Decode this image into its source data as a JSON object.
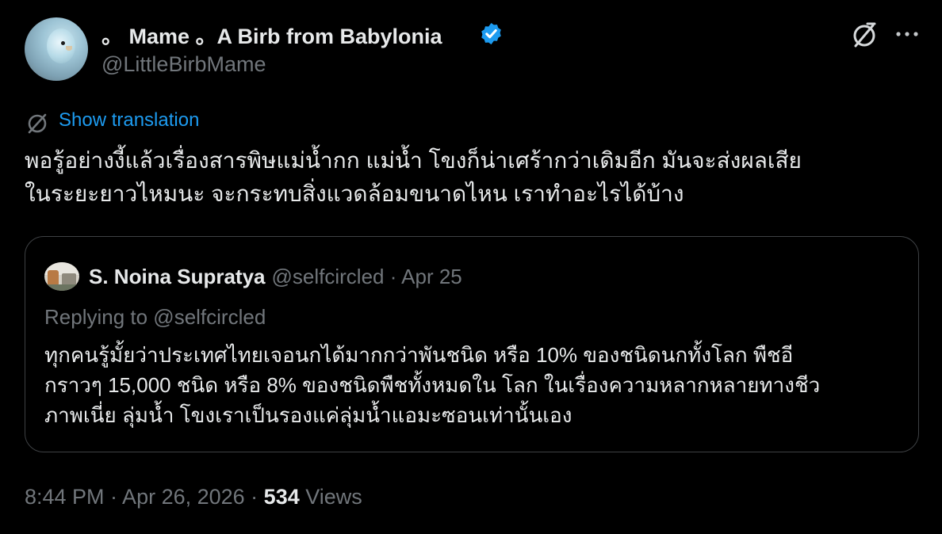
{
  "author": {
    "display_name": "。 Mame 。A Birb from Babylonia",
    "handle": "@LittleBirbMame"
  },
  "actions": {
    "grok_icon": "grok-icon",
    "more_icon": "more-icon"
  },
  "translation": {
    "label": "Show translation"
  },
  "tweet": {
    "line1": "พอรู้อย่างงี้แล้วเรื่องสารพิษแม่น้ำกก แม่น้ำ โขงก็น่าเศร้ากว่าเดิมอีก มันจะส่งผลเสีย",
    "line2": "ในระยะยาวไหมนะ จะกระทบสิ่งแวดล้อมขนาดไหน เราทำอะไรได้บ้าง"
  },
  "quoted": {
    "name": "S. Noina Supratya",
    "meta": "@selfcircled · Apr 25",
    "replying_to": "Replying to @selfcircled",
    "line1": "ทุกคนรู้มั้ยว่าประเทศไทยเจอนกได้มากกว่าพันชนิด หรือ 10% ของชนิดนกทั้งโลก พืชอี",
    "line2": "กราวๆ 15,000 ชนิด หรือ 8% ของชนิดพืชทั้งหมดใน โลก ในเรื่องความหลากหลายทางชีว",
    "line3": "ภาพเนี่ย ลุ่มน้ำ โขงเราเป็นรองแค่ลุ่มน้ำแอมะซอนเท่านั้นเอง"
  },
  "meta": {
    "timestamp": "8:44 PM · Apr 26, 2026 · ",
    "views_count": "534",
    "views_label": " Views"
  },
  "colors": {
    "accent": "#1d9bf0",
    "muted": "#71767b",
    "text": "#e7e9ea",
    "background": "#000000"
  }
}
